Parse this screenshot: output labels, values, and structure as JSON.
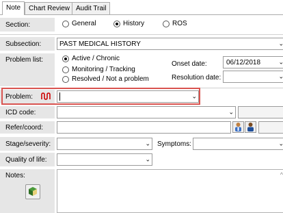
{
  "tabs": [
    {
      "label": "Note"
    },
    {
      "label": "Chart Review"
    },
    {
      "label": "Audit Trail"
    }
  ],
  "section": {
    "label": "Section:",
    "options": [
      "General",
      "History",
      "ROS"
    ],
    "selected": "History"
  },
  "subsection": {
    "label": "Subsection:",
    "value": "PAST MEDICAL HISTORY"
  },
  "problem_list": {
    "label": "Problem list:",
    "options": [
      "Active / Chronic",
      "Monitoring / Tracking",
      "Resolved / Not a problem"
    ],
    "selected": "Active / Chronic"
  },
  "onset_date": {
    "label": "Onset date:",
    "value": "06/12/2018"
  },
  "resolution_date": {
    "label": "Resolution date:",
    "value": ""
  },
  "problem": {
    "label": "Problem:",
    "value": "",
    "icon_color": "#cc0000"
  },
  "icd_code": {
    "label": "ICD code:",
    "value": ""
  },
  "refer_coord": {
    "label": "Refer/coord:",
    "value": ""
  },
  "stage_severity": {
    "label": "Stage/severity:",
    "value": ""
  },
  "symptoms": {
    "label": "Symptoms:",
    "value": ""
  },
  "quality_of_life": {
    "label": "Quality of life:",
    "value": ""
  },
  "notes": {
    "label": "Notes:",
    "value": ""
  },
  "colors": {
    "highlight_border": "#d9534f",
    "label_bg": "#e6e6e6"
  }
}
